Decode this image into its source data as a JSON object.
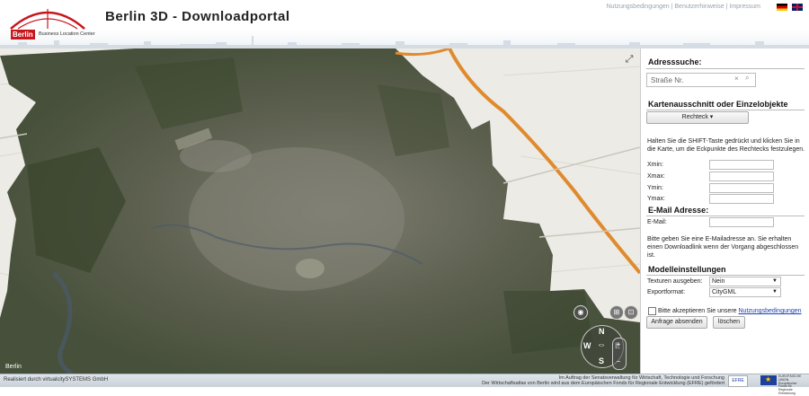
{
  "header": {
    "logo_badge": "Berlin",
    "logo_sub": "Business Location Center",
    "title": "Berlin 3D - Downloadportal",
    "links": [
      "Nutzungsbedingungen",
      "Benutzerhinweise",
      "Impressum"
    ],
    "separator": " | ",
    "flags": [
      "german-flag-icon",
      "english-flag-icon"
    ]
  },
  "map": {
    "expand_icon": "⤢",
    "attribution": "Berlin",
    "nav": {
      "north": "N",
      "south": "S",
      "east": "E",
      "west": "W",
      "pan_icon": "⇔",
      "tilt_icon": "⊞",
      "camera_icon": "◉",
      "reset_icon": "⊡"
    },
    "zoom": {
      "in": "+",
      "out": "−"
    },
    "colors": {
      "urban": "#6d6d62",
      "forest": "#3f4a32",
      "countryside": "#ecebe5",
      "highway": "#e08a2e",
      "water": "#4a5a6a"
    }
  },
  "panel": {
    "address": {
      "title": "Adresssuche:",
      "placeholder": "Straße Nr.",
      "clear_icon": "×",
      "search_icon": "⌕"
    },
    "selection": {
      "title": "Kartenausschnitt oder Einzelobjekte",
      "mode_button": "Rechteck ▾",
      "hint": "Halten Sie die SHIFT-Taste gedrückt und klicken Sie in die Karte, um die Eckpunkte des Rechtecks festzulegen.",
      "fields": [
        {
          "label": "Xmin:",
          "value": ""
        },
        {
          "label": "Xmax:",
          "value": ""
        },
        {
          "label": "Ymin:",
          "value": ""
        },
        {
          "label": "Ymax:",
          "value": ""
        }
      ]
    },
    "email": {
      "title": "E-Mail Adresse:",
      "label": "E-Mail:",
      "value": "",
      "hint": "Bitte geben Sie eine E-Mailadresse an. Sie erhalten einen Downloadlink wenn der Vorgang abgeschlossen ist."
    },
    "model": {
      "title": "Modelleinstellungen",
      "textures_label": "Texturen ausgeben:",
      "textures_value": "Nein",
      "format_label": "Exportformat:",
      "format_value": "CityGML"
    },
    "terms": {
      "text": "Bitte akzeptieren Sie unsere ",
      "link": "Nutzungsbedingungen",
      "checked": false
    },
    "buttons": {
      "submit": "Anfrage absenden",
      "clear": "löschen"
    }
  },
  "footer": {
    "left": "Realisiert durch virtualcitySYSTEMS GmbH",
    "right_line1": "Im Auftrag der Senatsverwaltung für Wirtschaft, Technologie und Forschung",
    "right_line2": "Der Wirtschaftsatlas von Berlin wird aus dem Europäischen Fonds für Regionale Entwicklung (EFRE) gefördert",
    "efre_logo": "EFRE",
    "eu_text": "EUROPÄISCHE UNION Europäischer Fonds für Regionale Entwicklung"
  }
}
